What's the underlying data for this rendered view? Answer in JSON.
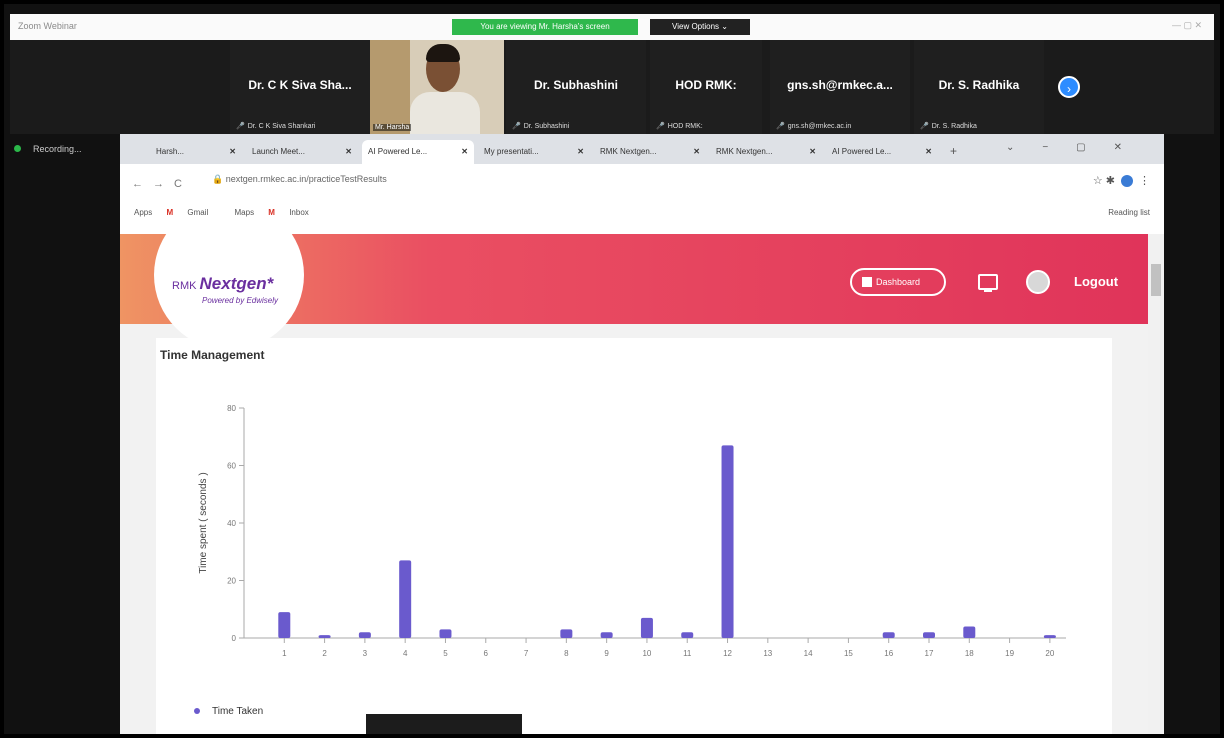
{
  "zoom": {
    "title": "Zoom Webinar",
    "viewing_banner": "You are viewing Mr. Harsha's screen",
    "view_options": "View Options ⌄",
    "participants": [
      {
        "name": "Dr. C K Siva Sha...",
        "sub": "Dr. C K Siva Shankari"
      },
      {
        "name": "Dr. Subhashini",
        "sub": "Dr. Subhashini"
      },
      {
        "name": "HOD RMK:",
        "sub": "HOD RMK:"
      },
      {
        "name": "gns.sh@rmkec.a...",
        "sub": "gns.sh@rmkec.ac.in"
      },
      {
        "name": "Dr. S. Radhika",
        "sub": "Dr. S. Radhika"
      }
    ],
    "video_label": "Mr. Harsha",
    "recording": "Recording..."
  },
  "browser": {
    "tabs": [
      {
        "label": "Harsh..."
      },
      {
        "label": "Launch Meet..."
      },
      {
        "label": "AI Powered Le..."
      },
      {
        "label": "My presentati..."
      },
      {
        "label": "RMK Nextgen..."
      },
      {
        "label": "RMK Nextgen..."
      },
      {
        "label": "AI Powered Le..."
      }
    ],
    "url": "nextgen.rmkec.ac.in/practiceTestResults",
    "bookmarks": [
      "Apps",
      "Gmail",
      "Maps",
      "Inbox"
    ],
    "reading_list": "Reading list"
  },
  "app": {
    "logo_prefix": "RMK",
    "logo_name": "Nextgen*",
    "logo_sub": "Powered by Edwisely",
    "dashboard": "Dashboard",
    "logout": "Logout",
    "section_title": "Time Management",
    "legend": "Time Taken"
  },
  "colors": {
    "bar": "#6a5acd",
    "header_start": "#ef9463",
    "header_end": "#e0345a"
  },
  "chart_data": {
    "type": "bar",
    "title": "",
    "xlabel": "",
    "ylabel": "Time spent ( seconds )",
    "categories": [
      "1",
      "2",
      "3",
      "4",
      "5",
      "6",
      "7",
      "8",
      "9",
      "10",
      "11",
      "12",
      "13",
      "14",
      "15",
      "16",
      "17",
      "18",
      "19",
      "20"
    ],
    "series": [
      {
        "name": "Time Taken",
        "values": [
          9,
          1,
          2,
          27,
          3,
          0,
          0,
          3,
          2,
          7,
          2,
          67,
          0,
          0,
          0,
          2,
          2,
          4,
          0,
          1
        ]
      }
    ],
    "ylim": [
      0,
      80
    ],
    "yticks": [
      0,
      20,
      40,
      60,
      80
    ],
    "grid": false,
    "legend": "bottom-left"
  }
}
